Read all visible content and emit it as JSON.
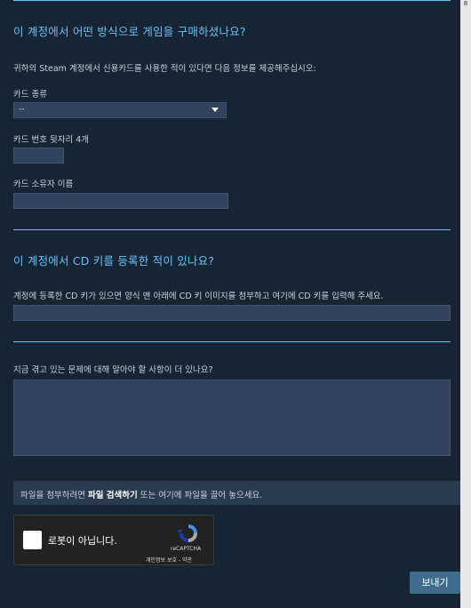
{
  "payment_section": {
    "title": "이 계정에서 어떤 방식으로 게임을 구매하셨나요?",
    "description": "귀하의 Steam 계정에서 신용카드를 사용한 적이 있다면 다음 정보를 제공해주십시오:",
    "card_type_label": "카드 종류",
    "card_type_value": "--",
    "card_last4_label": "카드 번호 뒷자리 4개",
    "card_holder_label": "카드 소유자 이름"
  },
  "cdkey_section": {
    "title": "이 계정에서 CD 키를 등록한 적이 있나요?",
    "description": "계정에 등록한 CD 키가 있으면 양식 맨 아래에 CD 키 이미지를 첨부하고 여기에 CD 키를 입력해 주세요."
  },
  "extra_section": {
    "description": "지금 겪고 있는 문제에 대해 알아야 할 사항이 더 있나요?"
  },
  "upload": {
    "prefix": "파일을 첨부하려면 ",
    "link": "파일 검색하기",
    "suffix": " 또는 여기에 파일을 끌어 놓으세요."
  },
  "captcha": {
    "label": "로봇이 아닙니다.",
    "brand": "reCAPTCHA",
    "links": "개인정보 보호 - 약관"
  },
  "submit_label": "보내기",
  "scrollbar_marker": "8",
  "colors": {
    "accent": "#67c1f5",
    "background": "#172433",
    "field": "#32445c",
    "button": "#3d6c8d"
  }
}
